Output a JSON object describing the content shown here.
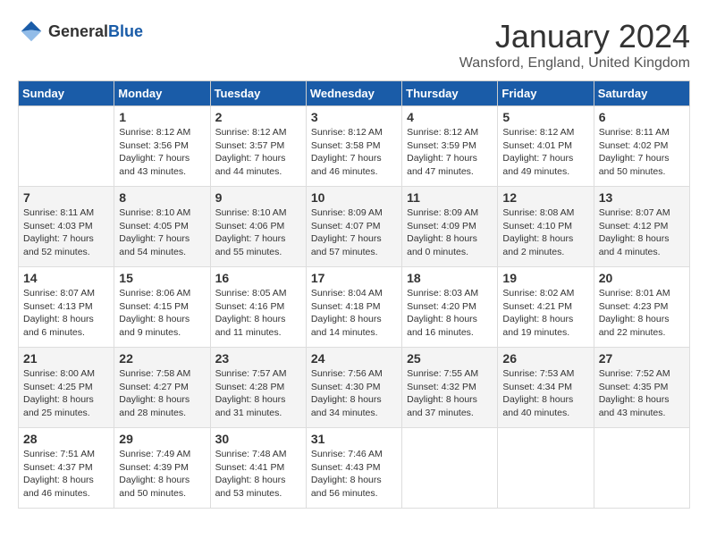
{
  "header": {
    "logo_general": "General",
    "logo_blue": "Blue",
    "title": "January 2024",
    "subtitle": "Wansford, England, United Kingdom"
  },
  "columns": [
    "Sunday",
    "Monday",
    "Tuesday",
    "Wednesday",
    "Thursday",
    "Friday",
    "Saturday"
  ],
  "weeks": [
    [
      {
        "day": "",
        "sunrise": "",
        "sunset": "",
        "daylight": ""
      },
      {
        "day": "1",
        "sunrise": "Sunrise: 8:12 AM",
        "sunset": "Sunset: 3:56 PM",
        "daylight": "Daylight: 7 hours and 43 minutes."
      },
      {
        "day": "2",
        "sunrise": "Sunrise: 8:12 AM",
        "sunset": "Sunset: 3:57 PM",
        "daylight": "Daylight: 7 hours and 44 minutes."
      },
      {
        "day": "3",
        "sunrise": "Sunrise: 8:12 AM",
        "sunset": "Sunset: 3:58 PM",
        "daylight": "Daylight: 7 hours and 46 minutes."
      },
      {
        "day": "4",
        "sunrise": "Sunrise: 8:12 AM",
        "sunset": "Sunset: 3:59 PM",
        "daylight": "Daylight: 7 hours and 47 minutes."
      },
      {
        "day": "5",
        "sunrise": "Sunrise: 8:12 AM",
        "sunset": "Sunset: 4:01 PM",
        "daylight": "Daylight: 7 hours and 49 minutes."
      },
      {
        "day": "6",
        "sunrise": "Sunrise: 8:11 AM",
        "sunset": "Sunset: 4:02 PM",
        "daylight": "Daylight: 7 hours and 50 minutes."
      }
    ],
    [
      {
        "day": "7",
        "sunrise": "Sunrise: 8:11 AM",
        "sunset": "Sunset: 4:03 PM",
        "daylight": "Daylight: 7 hours and 52 minutes."
      },
      {
        "day": "8",
        "sunrise": "Sunrise: 8:10 AM",
        "sunset": "Sunset: 4:05 PM",
        "daylight": "Daylight: 7 hours and 54 minutes."
      },
      {
        "day": "9",
        "sunrise": "Sunrise: 8:10 AM",
        "sunset": "Sunset: 4:06 PM",
        "daylight": "Daylight: 7 hours and 55 minutes."
      },
      {
        "day": "10",
        "sunrise": "Sunrise: 8:09 AM",
        "sunset": "Sunset: 4:07 PM",
        "daylight": "Daylight: 7 hours and 57 minutes."
      },
      {
        "day": "11",
        "sunrise": "Sunrise: 8:09 AM",
        "sunset": "Sunset: 4:09 PM",
        "daylight": "Daylight: 8 hours and 0 minutes."
      },
      {
        "day": "12",
        "sunrise": "Sunrise: 8:08 AM",
        "sunset": "Sunset: 4:10 PM",
        "daylight": "Daylight: 8 hours and 2 minutes."
      },
      {
        "day": "13",
        "sunrise": "Sunrise: 8:07 AM",
        "sunset": "Sunset: 4:12 PM",
        "daylight": "Daylight: 8 hours and 4 minutes."
      }
    ],
    [
      {
        "day": "14",
        "sunrise": "Sunrise: 8:07 AM",
        "sunset": "Sunset: 4:13 PM",
        "daylight": "Daylight: 8 hours and 6 minutes."
      },
      {
        "day": "15",
        "sunrise": "Sunrise: 8:06 AM",
        "sunset": "Sunset: 4:15 PM",
        "daylight": "Daylight: 8 hours and 9 minutes."
      },
      {
        "day": "16",
        "sunrise": "Sunrise: 8:05 AM",
        "sunset": "Sunset: 4:16 PM",
        "daylight": "Daylight: 8 hours and 11 minutes."
      },
      {
        "day": "17",
        "sunrise": "Sunrise: 8:04 AM",
        "sunset": "Sunset: 4:18 PM",
        "daylight": "Daylight: 8 hours and 14 minutes."
      },
      {
        "day": "18",
        "sunrise": "Sunrise: 8:03 AM",
        "sunset": "Sunset: 4:20 PM",
        "daylight": "Daylight: 8 hours and 16 minutes."
      },
      {
        "day": "19",
        "sunrise": "Sunrise: 8:02 AM",
        "sunset": "Sunset: 4:21 PM",
        "daylight": "Daylight: 8 hours and 19 minutes."
      },
      {
        "day": "20",
        "sunrise": "Sunrise: 8:01 AM",
        "sunset": "Sunset: 4:23 PM",
        "daylight": "Daylight: 8 hours and 22 minutes."
      }
    ],
    [
      {
        "day": "21",
        "sunrise": "Sunrise: 8:00 AM",
        "sunset": "Sunset: 4:25 PM",
        "daylight": "Daylight: 8 hours and 25 minutes."
      },
      {
        "day": "22",
        "sunrise": "Sunrise: 7:58 AM",
        "sunset": "Sunset: 4:27 PM",
        "daylight": "Daylight: 8 hours and 28 minutes."
      },
      {
        "day": "23",
        "sunrise": "Sunrise: 7:57 AM",
        "sunset": "Sunset: 4:28 PM",
        "daylight": "Daylight: 8 hours and 31 minutes."
      },
      {
        "day": "24",
        "sunrise": "Sunrise: 7:56 AM",
        "sunset": "Sunset: 4:30 PM",
        "daylight": "Daylight: 8 hours and 34 minutes."
      },
      {
        "day": "25",
        "sunrise": "Sunrise: 7:55 AM",
        "sunset": "Sunset: 4:32 PM",
        "daylight": "Daylight: 8 hours and 37 minutes."
      },
      {
        "day": "26",
        "sunrise": "Sunrise: 7:53 AM",
        "sunset": "Sunset: 4:34 PM",
        "daylight": "Daylight: 8 hours and 40 minutes."
      },
      {
        "day": "27",
        "sunrise": "Sunrise: 7:52 AM",
        "sunset": "Sunset: 4:35 PM",
        "daylight": "Daylight: 8 hours and 43 minutes."
      }
    ],
    [
      {
        "day": "28",
        "sunrise": "Sunrise: 7:51 AM",
        "sunset": "Sunset: 4:37 PM",
        "daylight": "Daylight: 8 hours and 46 minutes."
      },
      {
        "day": "29",
        "sunrise": "Sunrise: 7:49 AM",
        "sunset": "Sunset: 4:39 PM",
        "daylight": "Daylight: 8 hours and 50 minutes."
      },
      {
        "day": "30",
        "sunrise": "Sunrise: 7:48 AM",
        "sunset": "Sunset: 4:41 PM",
        "daylight": "Daylight: 8 hours and 53 minutes."
      },
      {
        "day": "31",
        "sunrise": "Sunrise: 7:46 AM",
        "sunset": "Sunset: 4:43 PM",
        "daylight": "Daylight: 8 hours and 56 minutes."
      },
      {
        "day": "",
        "sunrise": "",
        "sunset": "",
        "daylight": ""
      },
      {
        "day": "",
        "sunrise": "",
        "sunset": "",
        "daylight": ""
      },
      {
        "day": "",
        "sunrise": "",
        "sunset": "",
        "daylight": ""
      }
    ]
  ]
}
